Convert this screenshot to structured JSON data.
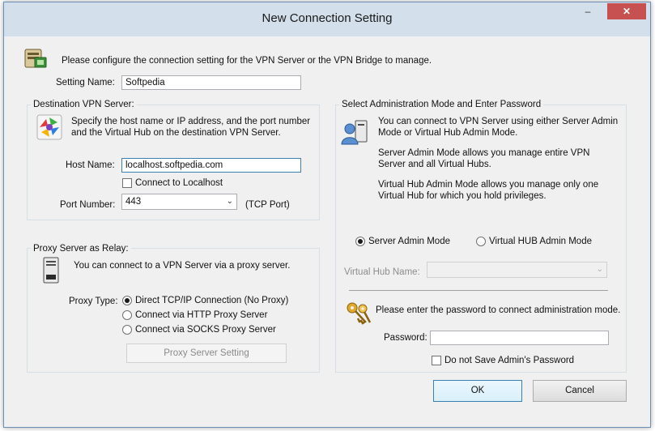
{
  "window": {
    "title": "New Connection Setting",
    "controls": {
      "minimize": "–",
      "maximize": "▭",
      "close": "✕"
    }
  },
  "intro": {
    "text": "Please configure the connection setting for the VPN Server or the VPN Bridge to manage.",
    "icon": "server-config-icon"
  },
  "setting_name": {
    "label": "Setting Name:",
    "value": "Softpedia"
  },
  "destination": {
    "group_title": "Destination VPN Server:",
    "desc_line1": "Specify the host name or IP address, and the port number",
    "desc_line2": "and the Virtual Hub on the destination VPN Server.",
    "host_label": "Host Name:",
    "host_value": "localhost.softpedia.com",
    "connect_localhost_label": "Connect to Localhost",
    "connect_localhost_checked": false,
    "port_label": "Port Number:",
    "port_value": "443",
    "port_suffix": "(TCP Port)"
  },
  "proxy": {
    "group_title": "Proxy Server as Relay:",
    "desc": "You can connect to a VPN Server via a proxy server.",
    "type_label": "Proxy Type:",
    "options": [
      {
        "label": "Direct TCP/IP Connection (No Proxy)",
        "selected": true
      },
      {
        "label": "Connect via HTTP Proxy Server",
        "selected": false
      },
      {
        "label": "Connect via SOCKS Proxy Server",
        "selected": false
      }
    ],
    "setting_button": "Proxy Server Setting"
  },
  "admin": {
    "group_title": "Select Administration Mode and Enter Password",
    "desc_p1_line1": "You can connect to VPN Server using either Server Admin",
    "desc_p1_line2": "Mode or Virtual Hub Admin Mode.",
    "desc_p2_line1": "Server Admin Mode allows you manage entire VPN",
    "desc_p2_line2": "Server and all Virtual Hubs.",
    "desc_p3_line1": "Virtual Hub Admin Mode allows you manage only one",
    "desc_p3_line2": "Virtual Hub for which you hold privileges.",
    "mode_server": "Server Admin Mode",
    "mode_hub": "Virtual HUB Admin Mode",
    "mode_selected": "server",
    "hub_name_label": "Virtual Hub Name:",
    "hub_name_value": "",
    "password_prompt": "Please enter the password to connect administration mode.",
    "password_label": "Password:",
    "password_value": "",
    "no_save_label": "Do not Save Admin's Password",
    "no_save_checked": false
  },
  "buttons": {
    "ok": "OK",
    "cancel": "Cancel"
  }
}
